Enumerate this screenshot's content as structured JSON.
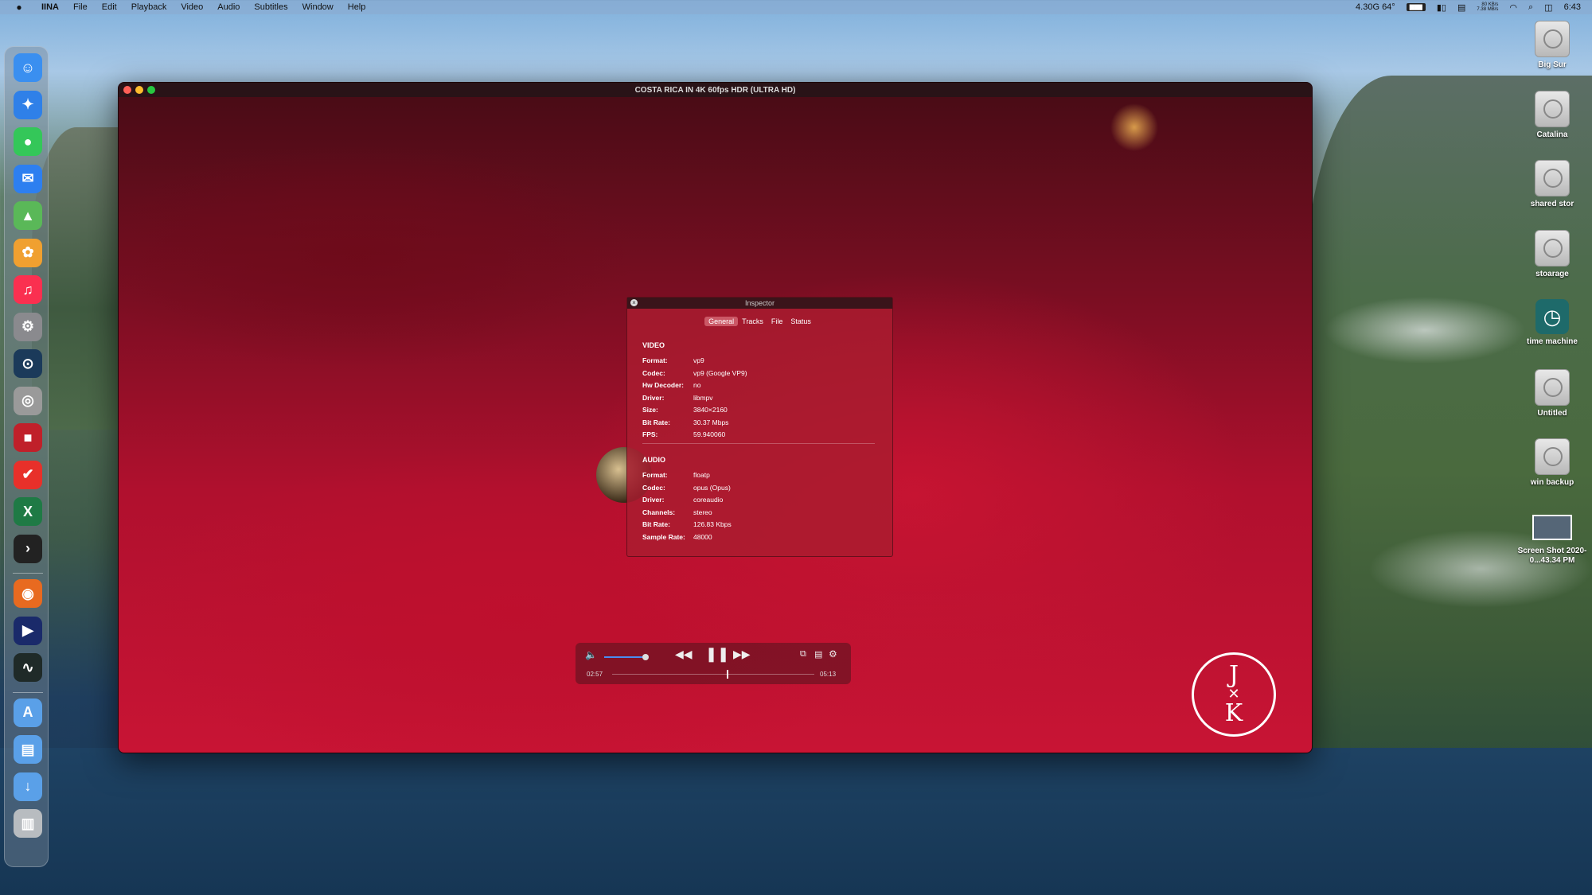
{
  "menubar": {
    "app_name": "IINA",
    "items": [
      "File",
      "Edit",
      "Playback",
      "Video",
      "Audio",
      "Subtitles",
      "Window",
      "Help"
    ],
    "status_text": "4.30G 64°",
    "net_up": "80 KB/s",
    "net_down": "7.38 MB/s",
    "clock": "6:43"
  },
  "window": {
    "title": "COSTA RICA IN 4K 60fps HDR (ULTRA HD)"
  },
  "inspector": {
    "title": "Inspector",
    "tabs": [
      "General",
      "Tracks",
      "File",
      "Status"
    ],
    "active_tab": "General",
    "video_heading": "VIDEO",
    "video": [
      {
        "k": "Format:",
        "v": "vp9"
      },
      {
        "k": "Codec:",
        "v": "vp9 (Google VP9)"
      },
      {
        "k": "Hw Decoder:",
        "v": "no"
      },
      {
        "k": "Driver:",
        "v": "libmpv"
      },
      {
        "k": "Size:",
        "v": "3840×2160"
      },
      {
        "k": "Bit Rate:",
        "v": "30.37 Mbps"
      },
      {
        "k": "FPS:",
        "v": "59.940060"
      }
    ],
    "audio_heading": "AUDIO",
    "audio": [
      {
        "k": "Format:",
        "v": "floatp"
      },
      {
        "k": "Codec:",
        "v": "opus (Opus)"
      },
      {
        "k": "Driver:",
        "v": "coreaudio"
      },
      {
        "k": "Channels:",
        "v": "stereo"
      },
      {
        "k": "Bit Rate:",
        "v": "126.83 Kbps"
      },
      {
        "k": "Sample Rate:",
        "v": "48000"
      }
    ]
  },
  "player": {
    "current_time": "02:57",
    "duration": "05:13",
    "volume": 1.0,
    "progress": 0.565
  },
  "logo": {
    "top": "J",
    "bottom": "K"
  },
  "desktop": [
    {
      "label": "Big Sur"
    },
    {
      "label": "Catalina"
    },
    {
      "label": "shared stor"
    },
    {
      "label": "stoarage"
    },
    {
      "label": "time machine"
    },
    {
      "label": "Untitled"
    },
    {
      "label": "win backup"
    },
    {
      "label": "Screen Shot 2020-0...43.34 PM"
    }
  ],
  "dock": [
    {
      "name": "finder-icon",
      "color": "#3a8ff0",
      "glyph": "☺"
    },
    {
      "name": "safari-icon",
      "color": "#2f80e8",
      "glyph": "✦"
    },
    {
      "name": "messages-icon",
      "color": "#34c759",
      "glyph": "●"
    },
    {
      "name": "mail-icon",
      "color": "#2d7ff0",
      "glyph": "✉"
    },
    {
      "name": "maps-icon",
      "color": "#5ab858",
      "glyph": "▲"
    },
    {
      "name": "photos-icon",
      "color": "#f0a030",
      "glyph": "✿"
    },
    {
      "name": "music-icon",
      "color": "#fa3050",
      "glyph": "♫"
    },
    {
      "name": "system-preferences-icon",
      "color": "#8a8a8e",
      "glyph": "⚙"
    },
    {
      "name": "steam-icon",
      "color": "#1b3a5a",
      "glyph": "⊙"
    },
    {
      "name": "disk-utility-icon",
      "color": "#9a9a9a",
      "glyph": "◎"
    },
    {
      "name": "toolbox-icon",
      "color": "#c0202a",
      "glyph": "■"
    },
    {
      "name": "todo-icon",
      "color": "#e8302a",
      "glyph": "✔"
    },
    {
      "name": "excel-icon",
      "color": "#1f7a45",
      "glyph": "X"
    },
    {
      "name": "terminal-icon",
      "color": "#222222",
      "glyph": "›"
    },
    {
      "name": "firefox-icon",
      "color": "#e86a20",
      "glyph": "◉"
    },
    {
      "name": "iina-icon",
      "color": "#1a2a6a",
      "glyph": "▶"
    },
    {
      "name": "activity-monitor-icon",
      "color": "#1f2a28",
      "glyph": "∿"
    },
    {
      "name": "applications-folder-icon",
      "color": "#5aa0e8",
      "glyph": "A"
    },
    {
      "name": "documents-folder-icon",
      "color": "#5aa0e8",
      "glyph": "▤"
    },
    {
      "name": "downloads-folder-icon",
      "color": "#5aa0e8",
      "glyph": "↓"
    },
    {
      "name": "trash-icon",
      "color": "#b8bcc0",
      "glyph": "▥"
    }
  ]
}
